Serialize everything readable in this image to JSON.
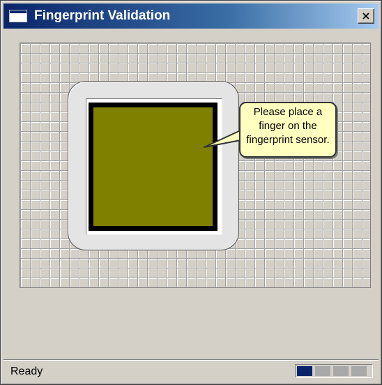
{
  "window": {
    "title": "Fingerprint Validation",
    "close_label": "×"
  },
  "sensor": {
    "callout_lines": [
      "Please place a",
      "finger on the",
      "fingerprint sensor."
    ],
    "pad_color": "#808000"
  },
  "status": {
    "text": "Ready",
    "progress_segments_total": 4,
    "progress_segments_active": 1,
    "progress_color": "#0a246a"
  }
}
